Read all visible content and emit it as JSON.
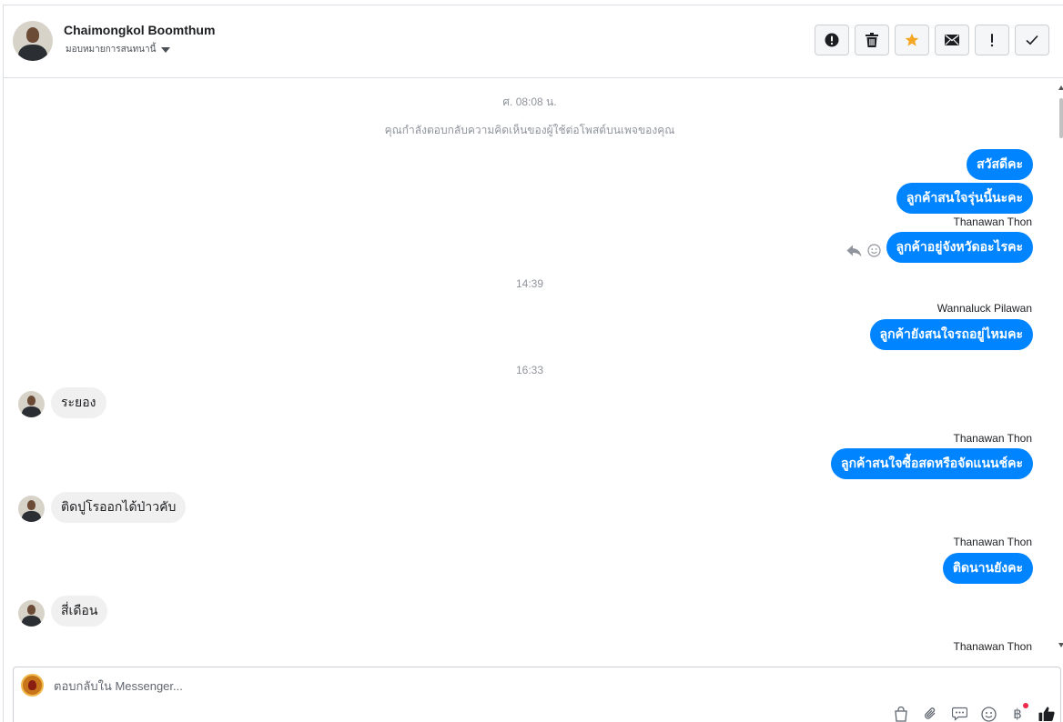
{
  "header": {
    "contact_name": "Chaimongkol Boomthum",
    "assign_label": "มอบหมายการสนทนานี้",
    "toolbar": [
      {
        "icon": "alert-circle-icon"
      },
      {
        "icon": "trash-icon"
      },
      {
        "icon": "star-icon",
        "color": "#f5a623"
      },
      {
        "icon": "envelope-icon"
      },
      {
        "icon": "exclamation-icon"
      },
      {
        "icon": "check-icon"
      }
    ]
  },
  "conversation": {
    "timestamp_1": "ศ. 08:08 น.",
    "notice": "คุณกำลังตอบกลับความคิดเห็นของผู้ใช้ต่อโพสต์บนเพจของคุณ",
    "out_1": "สวัสดีคะ",
    "out_2": "ลูกค้าสนใจรุ่นนี้นะคะ",
    "sender_1": "Thanawan Thon",
    "out_3": "ลูกค้าอยู่จังหวัดอะไรคะ",
    "timestamp_2": "14:39",
    "sender_2": "Wannaluck Pilawan",
    "out_4": "ลูกค้ายังสนใจรถอยู่ไหมคะ",
    "timestamp_3": "16:33",
    "in_1": "ระยอง",
    "sender_3": "Thanawan Thon",
    "out_5": "ลูกค้าสนใจซื้อสดหรือจัดแนนช์คะ",
    "in_2": "ติดปูโรออกได้ป่าวคับ",
    "sender_4": "Thanawan Thon",
    "out_6": "ติดนานยังคะ",
    "in_3": "สี่เดือน",
    "sender_5": "Thanawan Thon"
  },
  "composer": {
    "placeholder": "ตอบกลับใน Messenger...",
    "tools": [
      "bag-icon",
      "paperclip-icon",
      "chat-bubble-icon",
      "smiley-icon",
      "baht-icon",
      "thumbs-up-icon"
    ],
    "baht_symbol": "฿"
  },
  "colors": {
    "accent": "#0084ff",
    "incoming_bubble": "#f1f0f0",
    "star": "#f5a623",
    "notification_dot": "#f02849"
  }
}
